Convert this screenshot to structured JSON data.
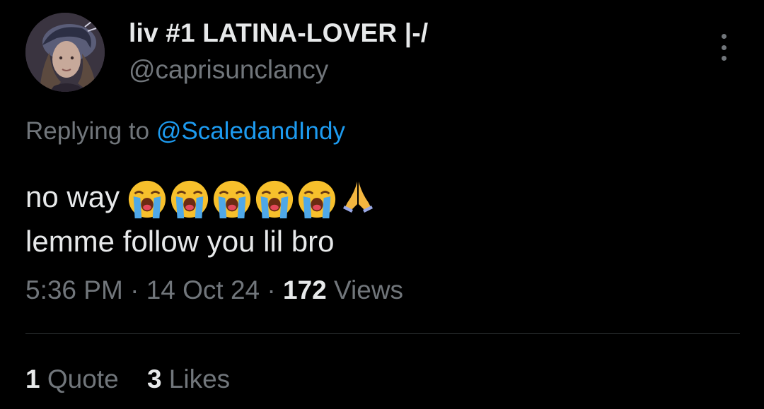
{
  "tweet": {
    "display_name": "liv #1 LATINA-LOVER |-/",
    "handle": "@caprisunclancy",
    "replying_prefix": "Replying to",
    "replying_to": "@ScaledandIndy",
    "text_line1": "no way",
    "text_line2": "lemme follow you lil bro",
    "emojis": [
      "loudly-crying-face-icon",
      "loudly-crying-face-icon",
      "loudly-crying-face-icon",
      "loudly-crying-face-icon",
      "loudly-crying-face-icon",
      "folded-hands-icon"
    ],
    "time": "5:36 PM",
    "date": "14 Oct 24",
    "sep": "·",
    "views_count": "172",
    "views_label": "Views",
    "quotes_count": "1",
    "quotes_label": "Quote",
    "likes_count": "3",
    "likes_label": "Likes"
  },
  "colors": {
    "background": "#000000",
    "primary_text": "#e7e9ea",
    "secondary_text": "#71767b",
    "link": "#1d9bf0",
    "divider": "#2f3336"
  }
}
